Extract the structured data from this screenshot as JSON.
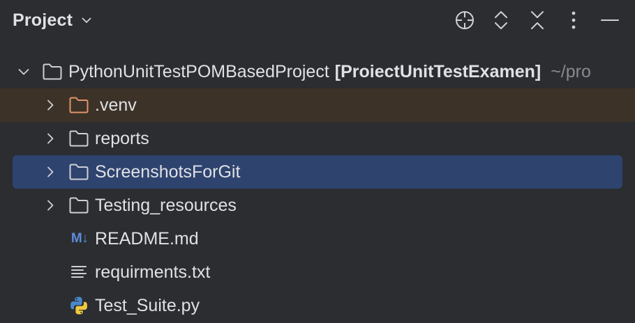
{
  "header": {
    "title": "Project",
    "icons": [
      "chevron-down-icon",
      "locate-icon",
      "expand-all-icon",
      "collapse-all-icon",
      "more-options-icon",
      "minimize-icon"
    ]
  },
  "tree": {
    "root": {
      "name": "PythonUnitTestPOMBasedProject",
      "module": "[ProiectUnitTestExamen]",
      "path": "~/pro"
    },
    "items": [
      {
        "label": ".venv",
        "type": "folder-excluded",
        "expandable": true
      },
      {
        "label": "reports",
        "type": "folder",
        "expandable": true
      },
      {
        "label": "ScreenshotsForGit",
        "type": "folder",
        "expandable": true,
        "selected": true
      },
      {
        "label": "Testing_resources",
        "type": "folder",
        "expandable": true
      },
      {
        "label": "README.md",
        "type": "markdown",
        "icon_text": "M↓",
        "expandable": false
      },
      {
        "label": "requirments.txt",
        "type": "text",
        "expandable": false
      },
      {
        "label": "Test_Suite.py",
        "type": "python",
        "expandable": false
      }
    ]
  },
  "colors": {
    "background": "#2b2d30",
    "selection": "#2e436e",
    "venv_highlight": "#3d3228",
    "excluded_folder": "#e0956d",
    "markdown_icon": "#5e8bdb",
    "text": "#dfe1e5",
    "muted": "#868a91"
  }
}
